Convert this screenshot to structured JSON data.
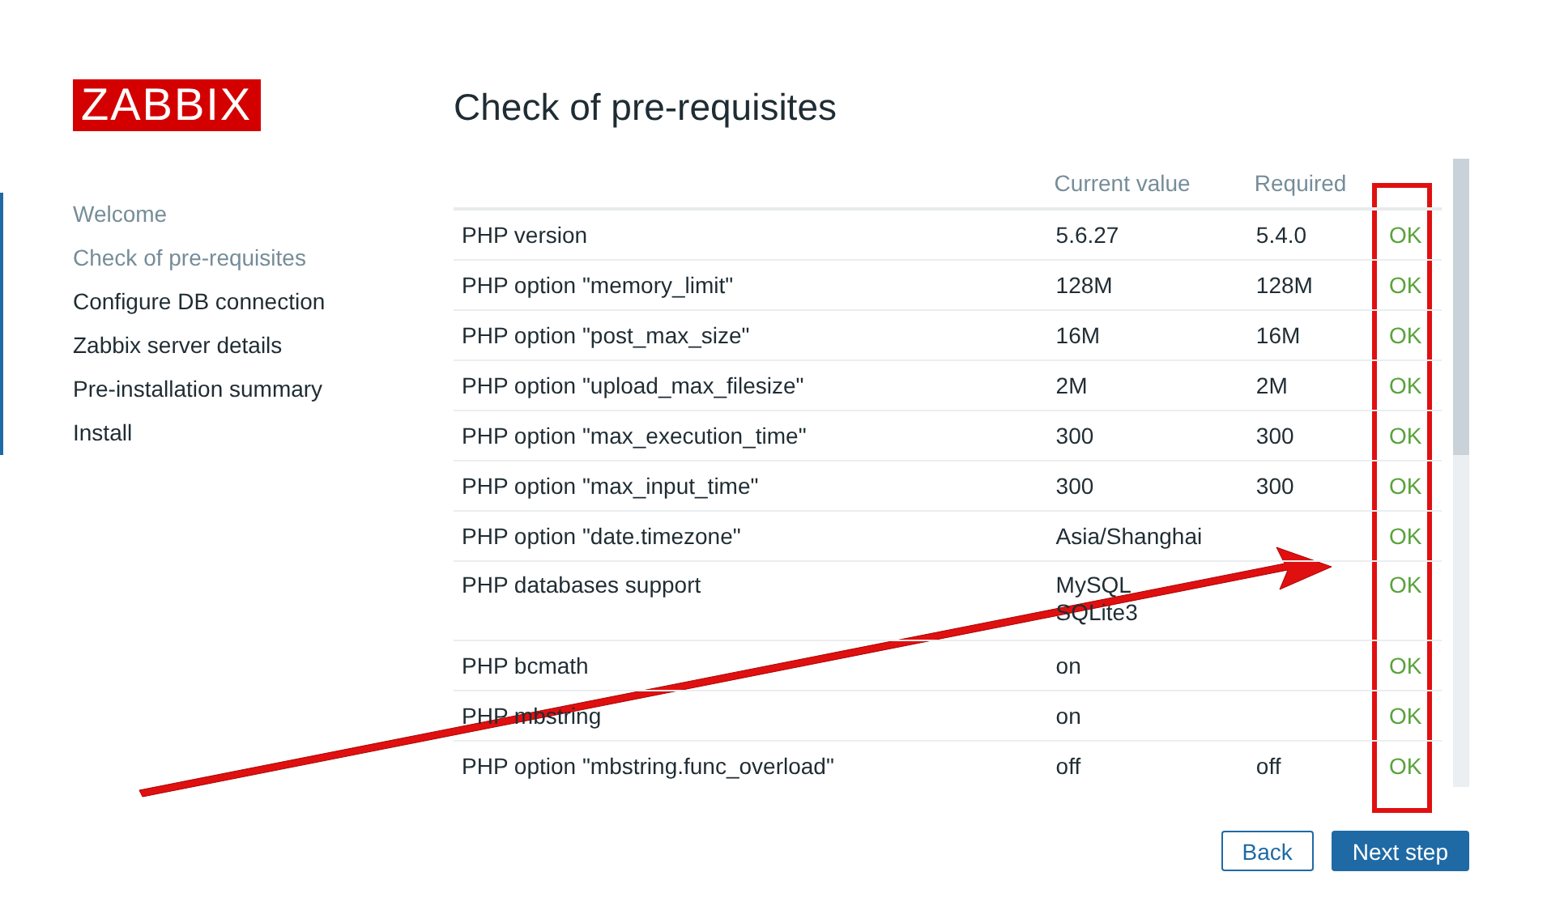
{
  "logo": "ZABBIX",
  "steps": [
    {
      "label": "Welcome",
      "visited": true
    },
    {
      "label": "Check of pre-requisites",
      "visited": true
    },
    {
      "label": "Configure DB connection",
      "visited": false
    },
    {
      "label": "Zabbix server details",
      "visited": false
    },
    {
      "label": "Pre-installation summary",
      "visited": false
    },
    {
      "label": "Install",
      "visited": false
    }
  ],
  "title": "Check of pre-requisites",
  "table": {
    "columns": [
      "Current value",
      "Required"
    ],
    "rows": [
      {
        "name": "PHP version",
        "current": [
          "5.6.27"
        ],
        "required": "5.4.0",
        "status": "OK",
        "passed": true
      },
      {
        "name": "PHP option \"memory_limit\"",
        "current": [
          "128M"
        ],
        "required": "128M",
        "status": "OK",
        "passed": true
      },
      {
        "name": "PHP option \"post_max_size\"",
        "current": [
          "16M"
        ],
        "required": "16M",
        "status": "OK",
        "passed": true
      },
      {
        "name": "PHP option \"upload_max_filesize\"",
        "current": [
          "2M"
        ],
        "required": "2M",
        "status": "OK",
        "passed": true
      },
      {
        "name": "PHP option \"max_execution_time\"",
        "current": [
          "300"
        ],
        "required": "300",
        "status": "OK",
        "passed": true
      },
      {
        "name": "PHP option \"max_input_time\"",
        "current": [
          "300"
        ],
        "required": "300",
        "status": "OK",
        "passed": true
      },
      {
        "name": "PHP option \"date.timezone\"",
        "current": [
          "Asia/Shanghai"
        ],
        "status": "OK",
        "passed": true
      },
      {
        "name": "PHP databases support",
        "current": [
          "MySQL",
          "SQLite3"
        ],
        "status": "OK",
        "passed": true
      },
      {
        "name": "PHP bcmath",
        "current": [
          "on"
        ],
        "status": "OK",
        "passed": true
      },
      {
        "name": "PHP mbstring",
        "current": [
          "on"
        ],
        "status": "OK",
        "passed": true
      },
      {
        "name": "PHP option \"mbstring.func_overload\"",
        "current": [
          "off"
        ],
        "required": "off",
        "status": "OK",
        "passed": true
      }
    ]
  },
  "buttons": {
    "back": "Back",
    "next": "Next step"
  }
}
